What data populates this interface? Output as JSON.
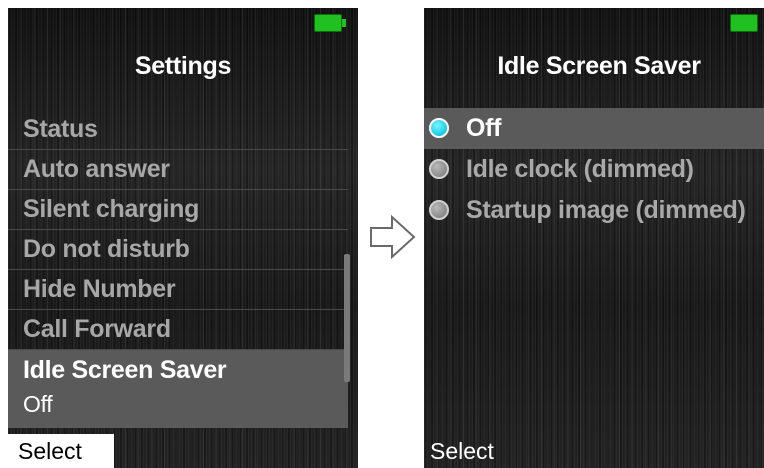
{
  "left_screen": {
    "title": "Settings",
    "menu_items": [
      {
        "label": "Status"
      },
      {
        "label": "Auto answer"
      },
      {
        "label": "Silent charging"
      },
      {
        "label": "Do not disturb"
      },
      {
        "label": "Hide Number"
      },
      {
        "label": "Call Forward"
      },
      {
        "label": "Idle Screen Saver",
        "value": "Off",
        "selected": true
      }
    ],
    "softkey_left": "Select",
    "battery_icon": "battery-full-icon",
    "battery_color": "#21c021"
  },
  "right_screen": {
    "title": "Idle Screen Saver",
    "options": [
      {
        "label": "Off",
        "selected": true
      },
      {
        "label": "Idle clock (dimmed)",
        "selected": false
      },
      {
        "label": "Startup image (dimmed)",
        "selected": false
      }
    ],
    "softkey_left": "Select",
    "battery_icon": "battery-full-icon",
    "radio_on_color": "#1dd4ec"
  },
  "transition_icon": "right-arrow-icon"
}
